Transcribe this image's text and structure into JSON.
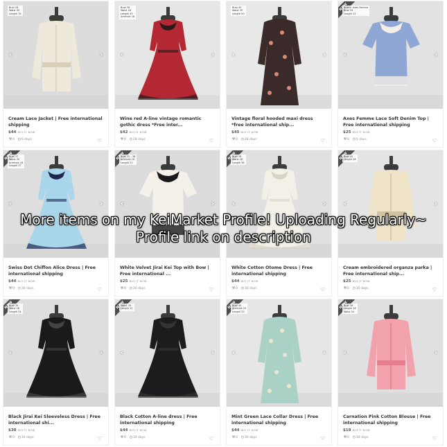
{
  "listings": [
    {
      "title": "Cream Lace Jacket | Free international shipping",
      "price": "$44",
      "buy_now": "BUY IT NOW",
      "bids": "0",
      "time_left": "0 days",
      "tag": "Bust 28\nWaist 30\nLength 15",
      "new": false,
      "colors": {
        "bg": "#dcdcdc",
        "dress": "#efe9dc",
        "trim": "#d8cfbb"
      },
      "shape": "jacket"
    },
    {
      "title": "Wine red A-line vintage romantic gothic dress *Free inter...",
      "price": "$42",
      "buy_now": "BUY IT NOW",
      "bids": "0",
      "time_left": "28 days",
      "tag": "Bust 36\nWaist 28\nLength 45\nArmhole 16",
      "new": false,
      "colors": {
        "bg": "#e6e6e6",
        "dress": "#b32833",
        "trim": "#2b1a1a"
      },
      "shape": "dress"
    },
    {
      "title": "Vintage floral hooded maxi dress *free international ship...",
      "price": "$45",
      "buy_now": "BUY IT NOW",
      "bids": "0",
      "time_left": "28 days",
      "tag": "Bust 40\nWaist 30\nLength 50",
      "new": false,
      "colors": {
        "bg": "#e8e8e8",
        "dress": "#3a2b2a",
        "trim": "#d88a7a"
      },
      "shape": "maxi"
    },
    {
      "title": "Axes Femme Lace Soft Denim Top | Free international shipping",
      "price": "$25",
      "buy_now": "BUY IT NOW",
      "bids": "0",
      "time_left": "5 days",
      "tag": "Brand: Axes Femme\nBust 34\nLength 22",
      "new": true,
      "colors": {
        "bg": "#e2e2e2",
        "dress": "#8ea7d4",
        "trim": "#f4efe6"
      },
      "shape": "top"
    },
    {
      "title": "Swiss Dot Chiffon Alice Dress | Free international shipping",
      "price": "$44",
      "buy_now": "BUY IT NOW",
      "bids": "0",
      "time_left": "30 days",
      "tag": "Bust 37\nWaist 30\nArmhole 18\nLength 37",
      "new": true,
      "colors": {
        "bg": "#dedede",
        "dress": "#a9d6ea",
        "trim": "#1d2750"
      },
      "shape": "dress"
    },
    {
      "title": "White Velvet Jirai Kei Top with Bow | Free international ...",
      "price": "$25",
      "buy_now": "BUY IT NOW",
      "bids": "0",
      "time_left": "30 days",
      "tag": "Bust 32 - 36\nArmhole 16\nLength 21",
      "new": true,
      "colors": {
        "bg": "#dcdcdc",
        "dress": "#f4f1ea",
        "trim": "#1a1a1a"
      },
      "shape": "top"
    },
    {
      "title": "White Cotton Otome Dress | Free international shipping",
      "price": "$44",
      "buy_now": "BUY IT NOW",
      "bids": "0",
      "time_left": "30 days",
      "tag": "Bust 36\nWaist 28\nLength 38",
      "new": true,
      "colors": {
        "bg": "#e0e0e0",
        "dress": "#f3f0e8",
        "trim": "#d9d3c6"
      },
      "shape": "dress"
    },
    {
      "title": "Cream embroidered organza parka | Free international ship...",
      "price": "$25",
      "buy_now": "BUY IT NOW",
      "bids": "0",
      "time_left": "30 days",
      "tag": "Bust 40\nLength 28",
      "new": true,
      "colors": {
        "bg": "#e4e4e4",
        "dress": "#efe3c8",
        "trim": "#d4c3a0"
      },
      "shape": "jacket"
    },
    {
      "title": "Black Jirai Kei Sleeveless Dress | Free international shi...",
      "price": "$30",
      "buy_now": "BUY IT NOW",
      "bids": "0",
      "time_left": "30 days",
      "tag": "Bust 35\nWaist 28\nLength 34",
      "new": true,
      "colors": {
        "bg": "#dedede",
        "dress": "#1a1a1a",
        "trim": "#444444"
      },
      "shape": "dress"
    },
    {
      "title": "Black Cotton A-line dress | Free international shipping",
      "price": "$44",
      "buy_now": "BUY IT NOW",
      "bids": "0",
      "time_left": "30 days",
      "tag": "Waist 26\nLength 32",
      "new": true,
      "colors": {
        "bg": "#e2e2e2",
        "dress": "#1c1c1e",
        "trim": "#333333"
      },
      "shape": "dress"
    },
    {
      "title": "Mint Green Lace Collar Dress | Free international shipping",
      "price": "$44",
      "buy_now": "BUY IT NOW",
      "bids": "0",
      "time_left": "30 days",
      "tag": "Bust 40\nArmhole 20\nLength 33",
      "new": true,
      "colors": {
        "bg": "#e6e6e6",
        "dress": "#a9d1c5",
        "trim": "#efe6cf"
      },
      "shape": "maxi"
    },
    {
      "title": "Carnation Pink Cotton Blouse | Free international shipping",
      "price": "$19",
      "buy_now": "BUY IT NOW",
      "bids": "0",
      "time_left": "30 days",
      "tag": "Bust 36\nLength 16\nWaist 24",
      "new": true,
      "colors": {
        "bg": "#e0e0e0",
        "dress": "#f2a2ad",
        "trim": "#e57f8f"
      },
      "shape": "jacket"
    }
  ],
  "badge_text": "NEW",
  "arrows": {
    "left": "‹",
    "right": "›"
  },
  "icons": {
    "bids": "gavel-icon",
    "time": "clock-icon",
    "favorite": "heart-icon"
  },
  "overlay": {
    "line1": "More items on my KeiMarket Profile! Uploading Regularly~",
    "line2": "Profile link on description"
  }
}
